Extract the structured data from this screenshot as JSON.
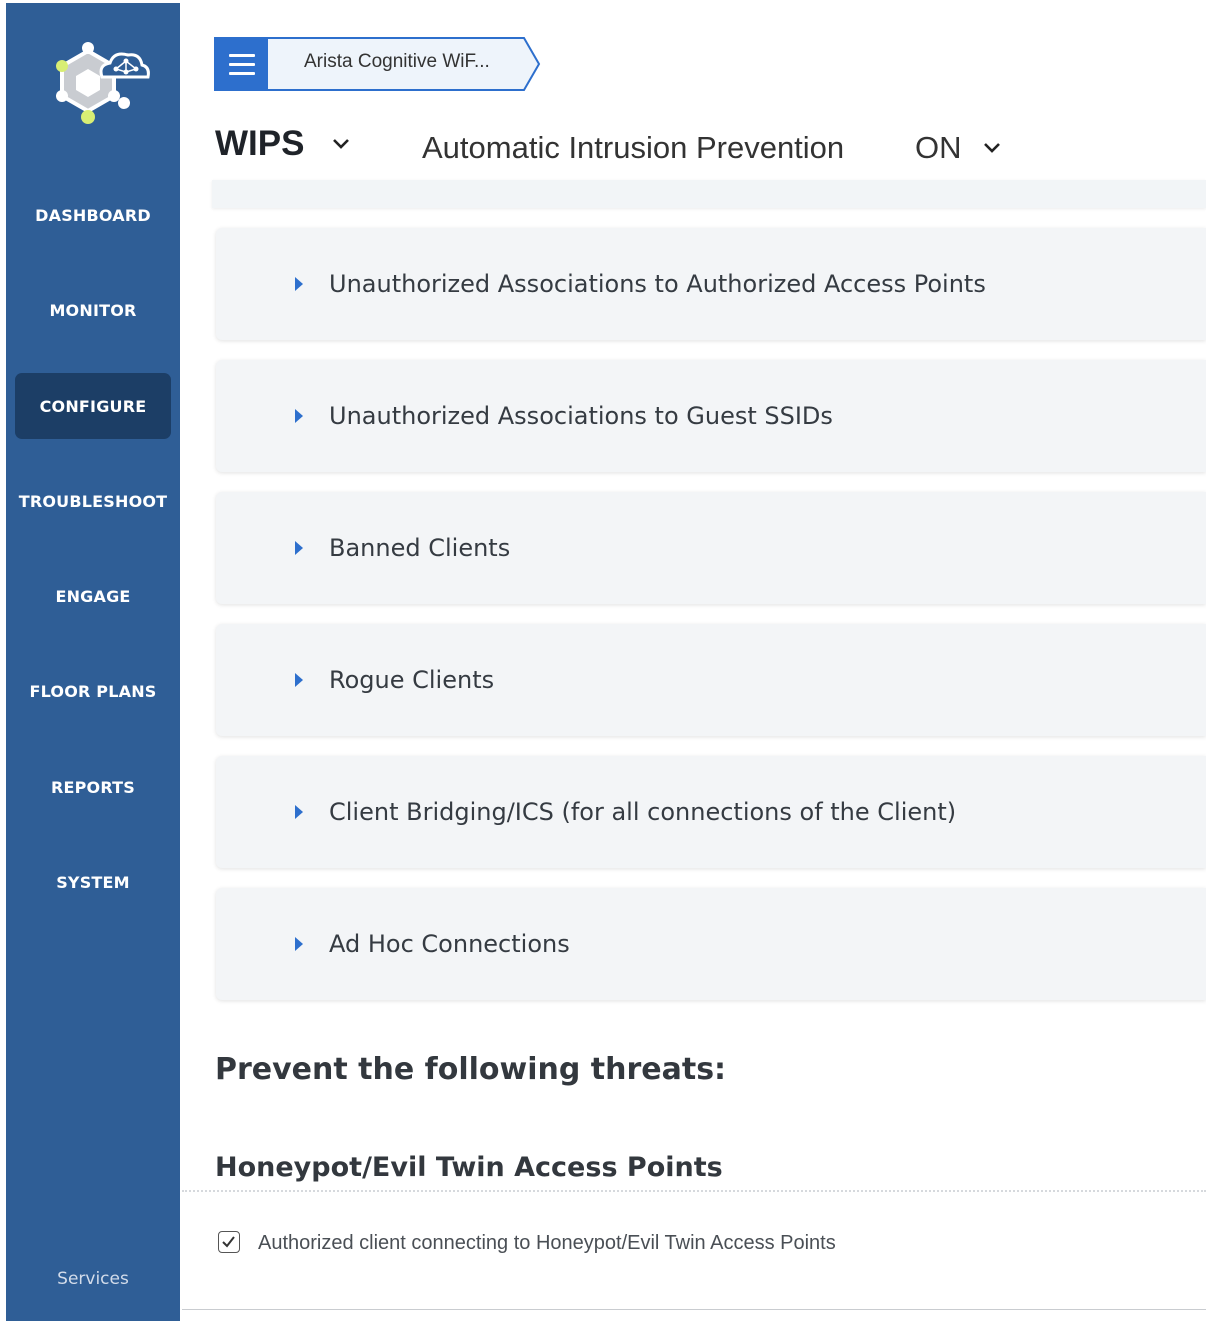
{
  "sidebar": {
    "logo": "arista-cloud-hex-logo",
    "items": [
      {
        "label": "DASHBOARD"
      },
      {
        "label": "MONITOR"
      },
      {
        "label": "CONFIGURE",
        "active": true
      },
      {
        "label": "TROUBLESHOOT"
      },
      {
        "label": "ENGAGE"
      },
      {
        "label": "FLOOR PLANS"
      },
      {
        "label": "REPORTS"
      },
      {
        "label": "SYSTEM"
      }
    ],
    "footer": "Services",
    "bg_color": "#2f5e96",
    "active_color": "#1c3e66"
  },
  "breadcrumb": {
    "menu_icon": "hamburger-icon",
    "label": "Arista Cognitive WiF...",
    "accent": "#2d6fcd"
  },
  "header": {
    "title": "WIPS",
    "aip_label": "Automatic Intrusion Prevention",
    "aip_value": "ON"
  },
  "panels": [
    {
      "label": "Unauthorized Associations to Authorized Access Points"
    },
    {
      "label": "Unauthorized Associations to Guest SSIDs"
    },
    {
      "label": "Banned Clients"
    },
    {
      "label": "Rogue Clients"
    },
    {
      "label": "Client Bridging/ICS (for all connections of the Client)"
    },
    {
      "label": "Ad Hoc Connections"
    }
  ],
  "prevent": {
    "title": "Prevent the following threats:",
    "subtitle": "Honeypot/Evil Twin Access Points",
    "checkbox_label": "Authorized client connecting to Honeypot/Evil Twin Access Points",
    "checkbox_checked": true
  }
}
